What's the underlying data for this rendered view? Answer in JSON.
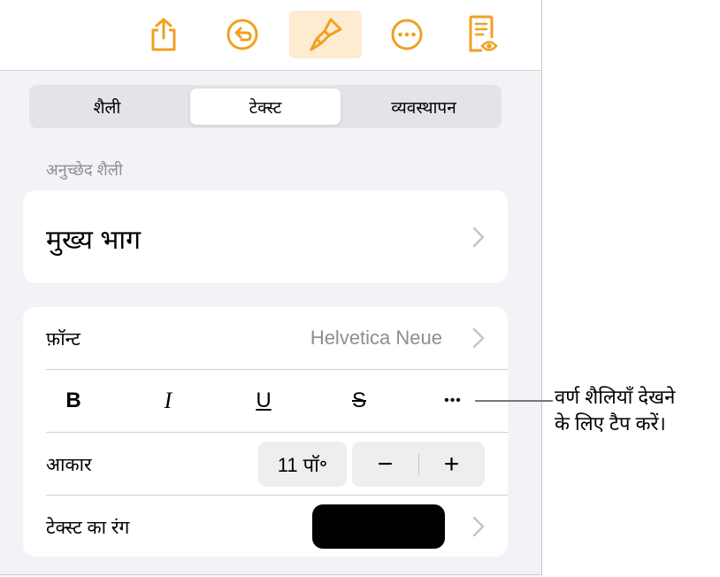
{
  "toolbar": {
    "buttons": [
      {
        "name": "share",
        "icon": "share-icon"
      },
      {
        "name": "undo",
        "icon": "undo-icon"
      },
      {
        "name": "format",
        "icon": "paintbrush-icon",
        "active": true
      },
      {
        "name": "more",
        "icon": "ellipsis-circle-icon"
      },
      {
        "name": "reading-view",
        "icon": "document-eye-icon"
      }
    ],
    "accent_color": "#f0a023"
  },
  "tabs": [
    {
      "label": "शैली"
    },
    {
      "label": "टेक्स्ट",
      "selected": true
    },
    {
      "label": "व्यवस्थापन"
    }
  ],
  "paragraph_style": {
    "section_label": "अनुच्छेद शैली",
    "value": "मुख्य भाग"
  },
  "font": {
    "label": "फ़ॉन्ट",
    "value": "Helvetica Neue"
  },
  "char_styles": {
    "bold": "B",
    "italic": "I",
    "underline": "U",
    "strikethrough": "S",
    "more": "•••"
  },
  "size": {
    "label": "आकार",
    "value": "11 पॉ॰",
    "decrease": "−",
    "increase": "+"
  },
  "text_color": {
    "label": "टेक्स्ट का रंग",
    "swatch": "#000000"
  },
  "callout": {
    "line1": "वर्ण शैलियाँ देखने",
    "line2": "के लिए टैप करें।"
  }
}
